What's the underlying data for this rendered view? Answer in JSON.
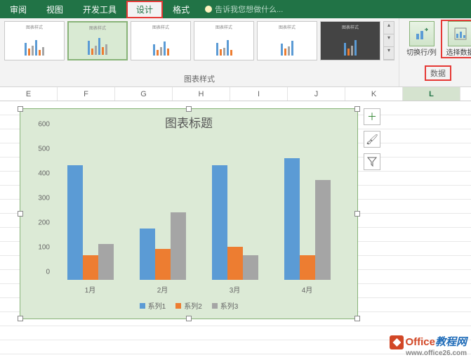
{
  "tabs": {
    "review": "审阅",
    "view": "视图",
    "dev": "开发工具",
    "design": "设计",
    "format": "格式"
  },
  "tellme": "告诉我您想做什么...",
  "groups": {
    "styles": "图表样式",
    "data": "数据"
  },
  "data_buttons": {
    "switch": "切换行/列",
    "select": "选择数据"
  },
  "columns": [
    "E",
    "F",
    "G",
    "H",
    "I",
    "J",
    "K",
    "L"
  ],
  "side_btns": {
    "add": "＋",
    "brush": "🖌",
    "filter": "▾"
  },
  "watermark": {
    "brand1": "Office",
    "brand2": "教程网",
    "url": "www.office26.com"
  },
  "chart_data": {
    "type": "bar",
    "title": "图表标题",
    "categories": [
      "1月",
      "2月",
      "3月",
      "4月"
    ],
    "series": [
      {
        "name": "系列1",
        "values": [
          465,
          210,
          465,
          495
        ],
        "color": "#5b9bd5"
      },
      {
        "name": "系列2",
        "values": [
          100,
          125,
          135,
          100
        ],
        "color": "#ed7d31"
      },
      {
        "name": "系列3",
        "values": [
          145,
          275,
          100,
          405
        ],
        "color": "#a5a5a5"
      }
    ],
    "ylim": [
      0,
      600
    ],
    "yticks": [
      0,
      100,
      200,
      300,
      400,
      500,
      600
    ]
  }
}
